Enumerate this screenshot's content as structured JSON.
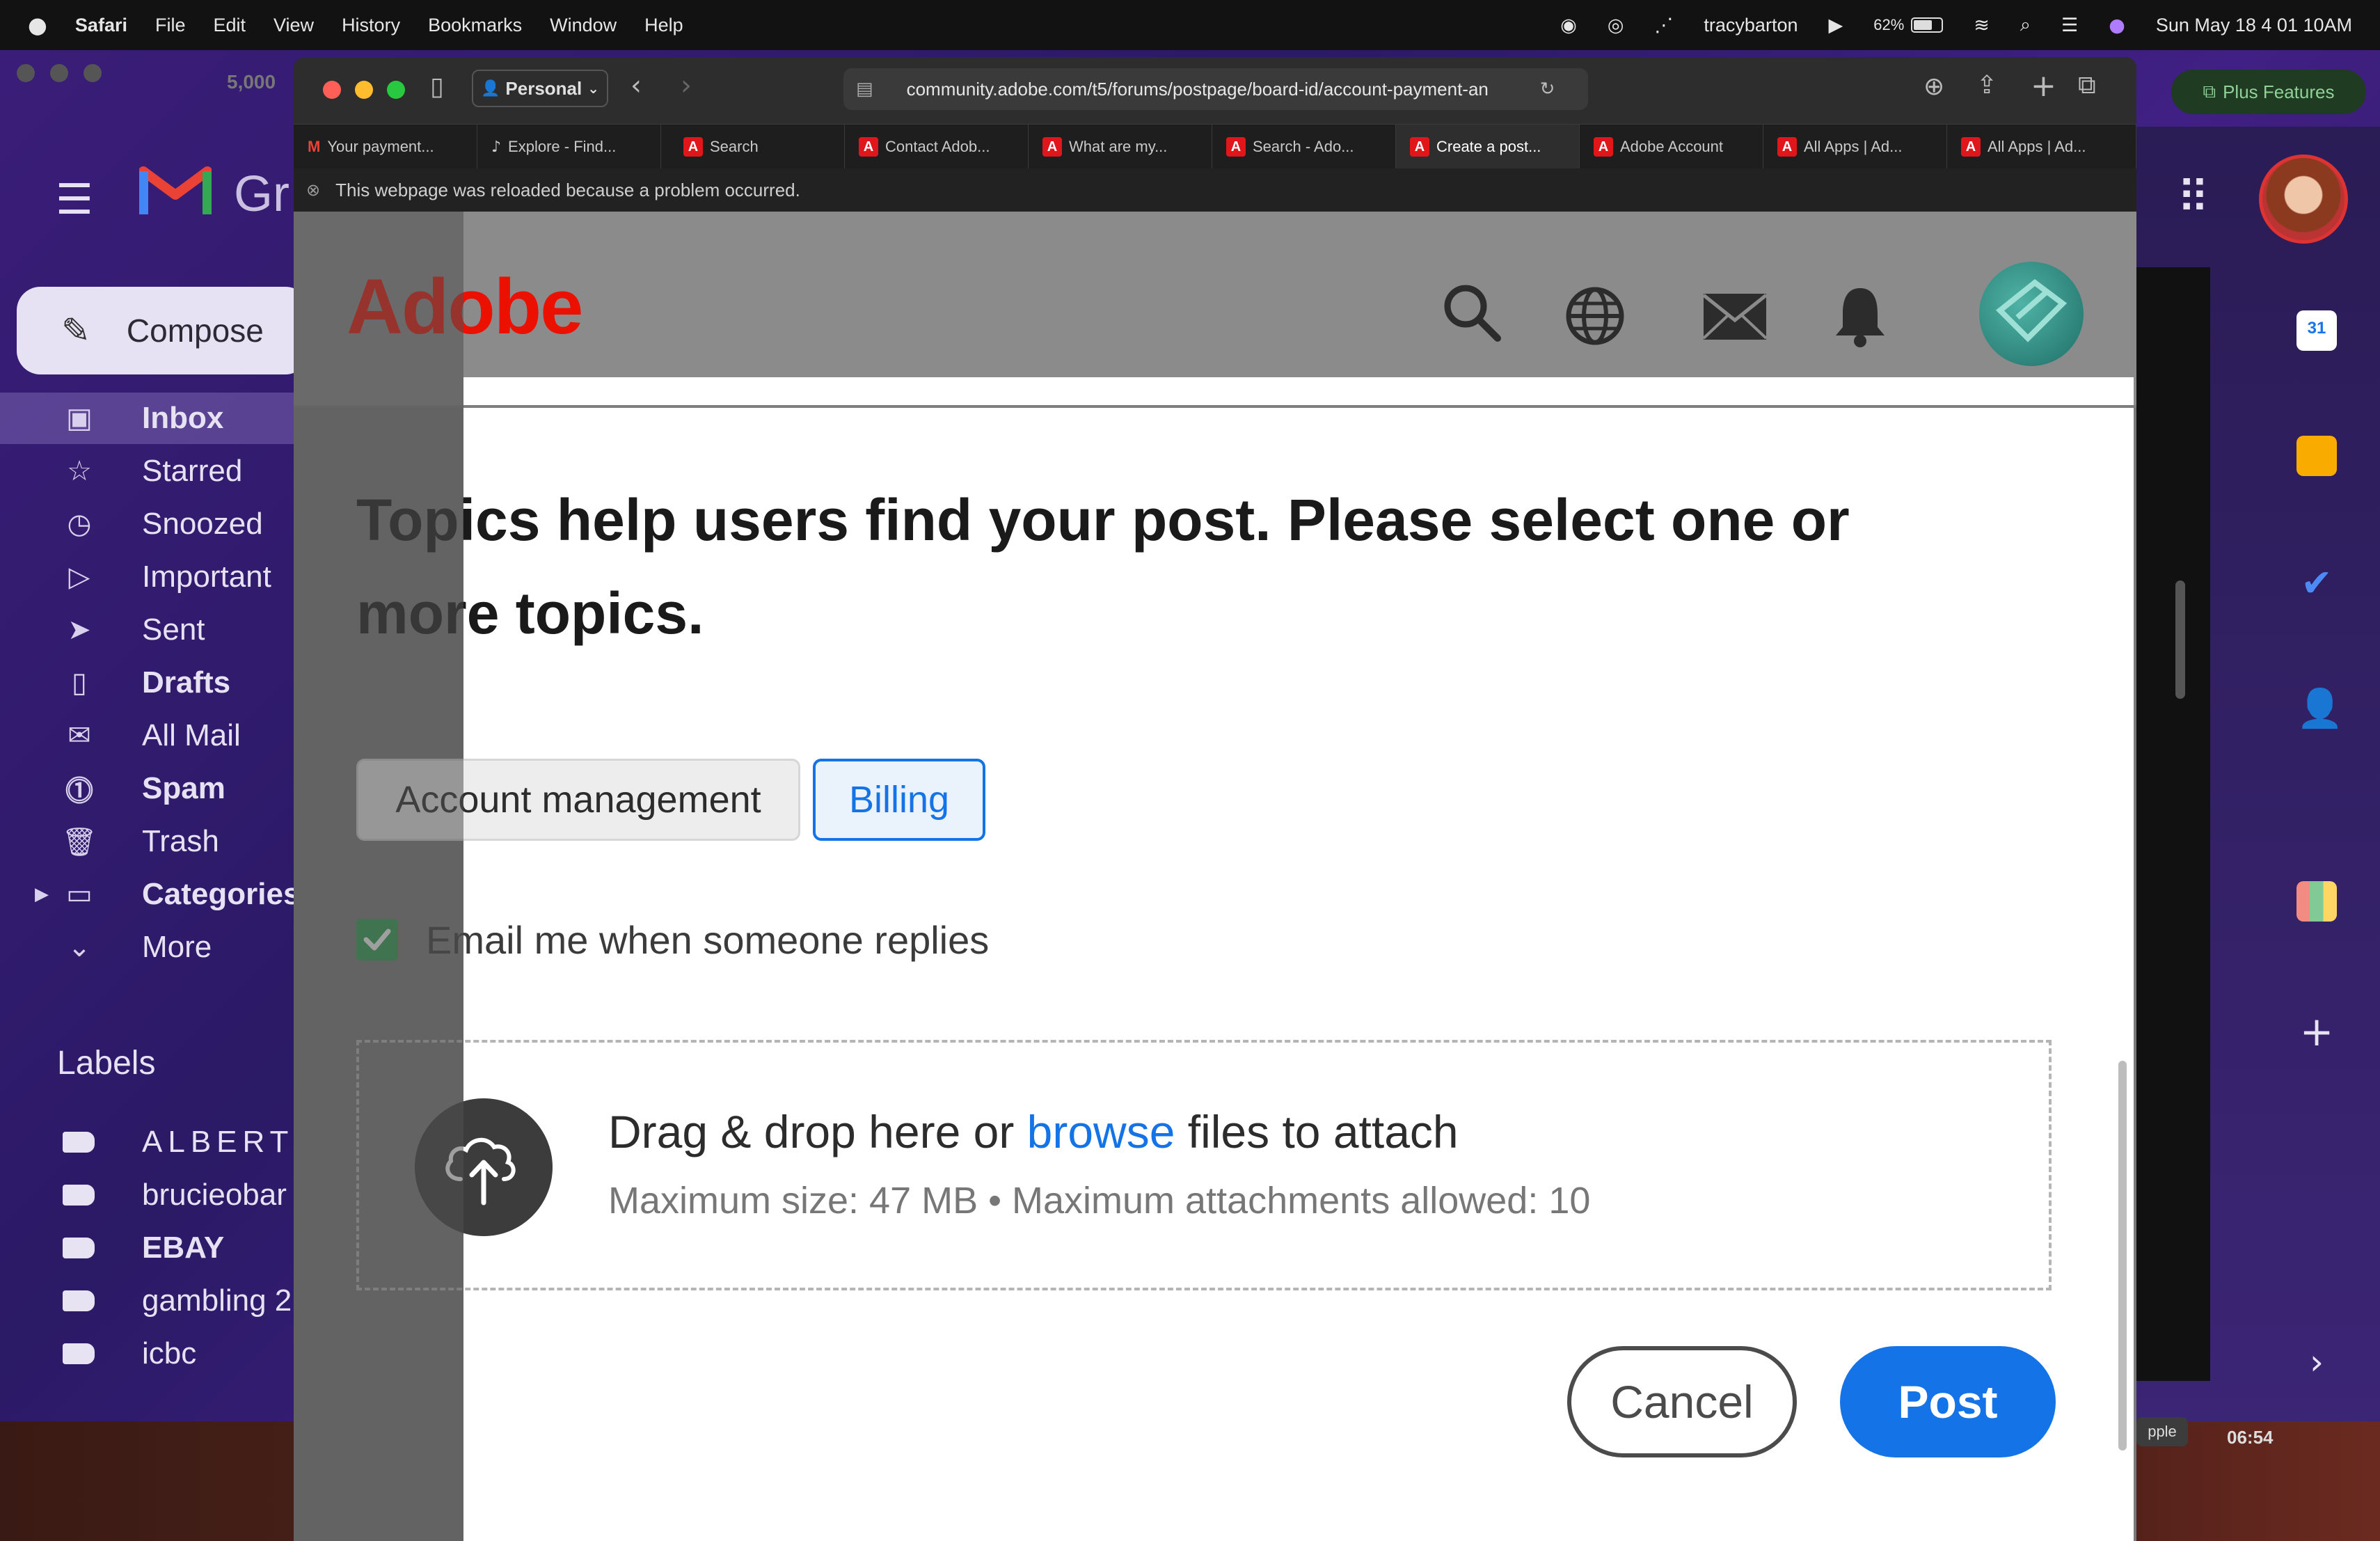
{
  "menubar": {
    "app": "Safari",
    "menus": [
      "File",
      "Edit",
      "View",
      "History",
      "Bookmarks",
      "Window",
      "Help"
    ],
    "user": "tracybarton",
    "battery": "62%",
    "datetime": "Sun May 18  4 01 10AM"
  },
  "gmail": {
    "logo_text": "Gr",
    "compose": "Compose",
    "nav": [
      "Inbox",
      "Starred",
      "Snoozed",
      "Important",
      "Sent",
      "Drafts",
      "All Mail",
      "Spam",
      "Trash",
      "Categories",
      "More"
    ],
    "labels_title": "Labels",
    "labels": [
      "ALBERT",
      "brucieobar",
      "EBAY",
      "gambling 2",
      "icbc"
    ],
    "counter": "5,000",
    "plus_features": "Plus Features",
    "clock": "06:54",
    "apple_tag": "pple"
  },
  "safari": {
    "profile": "Personal",
    "url": "community.adobe.com/t5/forums/postpage/board-id/account-payment-an",
    "tabs": [
      "Your payment...",
      "Explore - Find...",
      "Search",
      "Contact Adob...",
      "What are my...",
      "Search - Ado...",
      "Create a post...",
      "Adobe Account",
      "All Apps | Ad...",
      "All Apps | Ad..."
    ],
    "notice": "This webpage was reloaded because a problem occurred."
  },
  "page": {
    "brand": "Adobe",
    "heading": "Topics help users find your post. Please select one or more topics.",
    "topics": [
      "Account management",
      "Billing"
    ],
    "email_opt": "Email me when someone replies",
    "drop_prefix": "Drag & drop here or ",
    "drop_link": "browse",
    "drop_suffix": " files to attach",
    "drop_info": "Maximum size: 47 MB • Maximum attachments allowed: 10",
    "cancel": "Cancel",
    "post": "Post"
  },
  "colors": {
    "adobe_red": "#eb1000",
    "primary_blue": "#1473e6"
  }
}
